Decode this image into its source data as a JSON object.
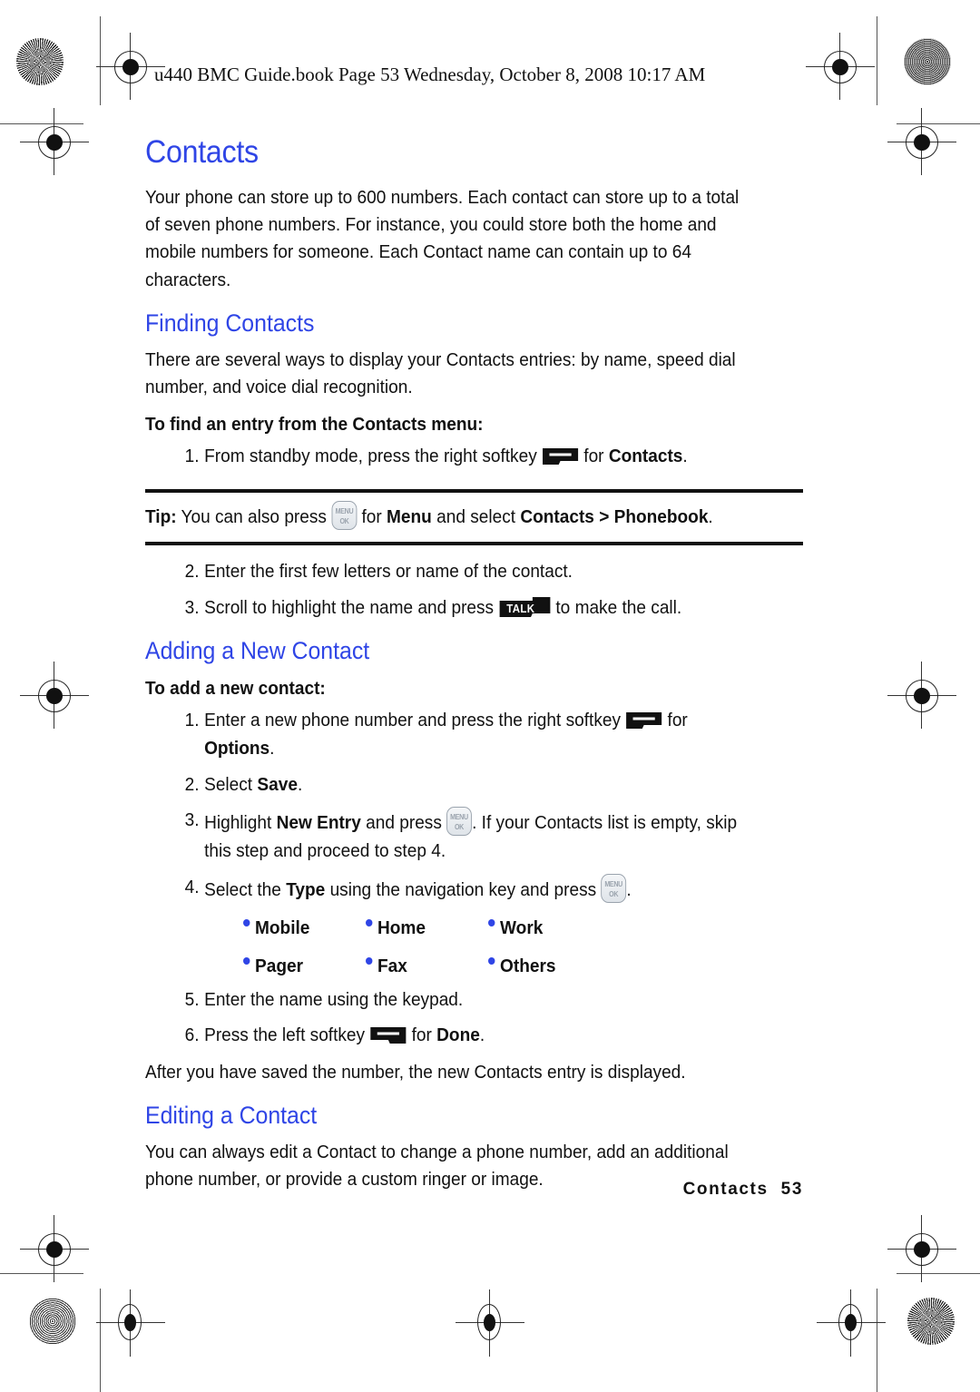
{
  "header": {
    "print_line": "u440 BMC Guide.book  Page 53  Wednesday, October 8, 2008  10:17 AM"
  },
  "chapter": {
    "title": "Contacts",
    "intro": "Your phone can store up to 600 numbers. Each contact can store up to a total of seven phone numbers. For instance, you could store both the home and mobile numbers for someone. Each Contact name can contain up to 64 characters."
  },
  "finding": {
    "heading": "Finding Contacts",
    "intro": "There are several ways to display your Contacts entries: by name, speed dial number, and voice dial recognition.",
    "subhead": "To find an entry from the Contacts menu:",
    "step1": {
      "num": "1.",
      "before": "From standby mode, press the right softkey",
      "after_pre": "for",
      "after_bold": "Contacts",
      "after_post": "."
    },
    "step2": {
      "num": "2.",
      "text": "Enter the first few letters or name of the contact."
    },
    "step3": {
      "num": "3.",
      "before": "Scroll to highlight the name and press",
      "after": "to make the call."
    }
  },
  "tip": {
    "label": "Tip:",
    "before": "You can also press",
    "mid_pre": "for",
    "mid_bold": "Menu",
    "mid_post": "and select",
    "bold_path": "Contacts > Phonebook",
    "end": "."
  },
  "adding": {
    "heading": "Adding a New Contact",
    "subhead": "To add a new contact:",
    "step1": {
      "num": "1.",
      "before": "Enter a new phone number and press the right softkey",
      "after_pre": "for",
      "after_bold": "Options",
      "after_post": "."
    },
    "step2": {
      "num": "2.",
      "pre": "Select",
      "bold": "Save",
      "post": "."
    },
    "step3": {
      "num": "3.",
      "pre": "Highlight",
      "bold": "New Entry",
      "mid": "and press",
      "post": ". If your Contacts list is empty, skip this step and proceed to step 4."
    },
    "step4": {
      "num": "4.",
      "pre": "Select the",
      "bold": "Type",
      "mid": "using the navigation key and press",
      "post": "."
    },
    "types": [
      "Mobile",
      "Home",
      "Work",
      "Pager",
      "Fax",
      "Others"
    ],
    "step5": {
      "num": "5.",
      "text": "Enter the name using the keypad."
    },
    "step6": {
      "num": "6.",
      "before": "Press the left softkey",
      "after_pre": "for",
      "after_bold": "Done",
      "after_post": "."
    },
    "closing": "After you have saved the number, the new Contacts entry is displayed."
  },
  "editing": {
    "heading": "Editing a Contact",
    "body": "You can always edit a Contact to change a phone number, add an additional phone number, or provide a custom ringer or image."
  },
  "keys": {
    "menuok_line1": "MENU",
    "menuok_line2": "OK",
    "talk_label": "TALK"
  },
  "footer": {
    "chapter": "Contacts",
    "page": "53"
  },
  "colors": {
    "heading_blue": "#2f45e6",
    "bullet_blue": "#2f45e6",
    "text_black": "#111111"
  }
}
